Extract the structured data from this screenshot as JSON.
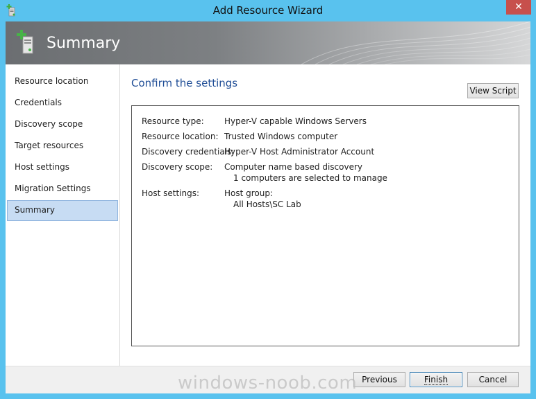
{
  "window": {
    "title": "Add Resource Wizard",
    "close_glyph": "✕"
  },
  "header": {
    "title": "Summary",
    "icon": "server-add-icon"
  },
  "sidebar": {
    "items": [
      {
        "label": "Resource location",
        "selected": false
      },
      {
        "label": "Credentials",
        "selected": false
      },
      {
        "label": "Discovery scope",
        "selected": false
      },
      {
        "label": "Target resources",
        "selected": false
      },
      {
        "label": "Host settings",
        "selected": false
      },
      {
        "label": "Migration Settings",
        "selected": false
      },
      {
        "label": "Summary",
        "selected": true
      }
    ]
  },
  "main": {
    "heading": "Confirm the settings",
    "view_script_label": "View Script",
    "summary": {
      "resource_type_label": "Resource type:",
      "resource_type_value": "Hyper-V capable Windows Servers",
      "resource_location_label": "Resource location:",
      "resource_location_value": "Trusted Windows computer",
      "discovery_credentials_label": "Discovery credentials:",
      "discovery_credentials_value": "Hyper-V Host Administrator Account",
      "discovery_scope_label": "Discovery scope:",
      "discovery_scope_value": "Computer name based discovery",
      "discovery_scope_detail": "1 computers are selected to manage",
      "host_settings_label": "Host settings:",
      "host_settings_value": "Host group:",
      "host_settings_detail": "All Hosts\\SC Lab"
    }
  },
  "footer": {
    "previous_label": "Previous",
    "finish_label": "Finish",
    "cancel_label": "Cancel"
  },
  "watermark": "windows-noob.com",
  "colors": {
    "titlebar": "#59c2ee",
    "heading": "#1f4d96",
    "selected_nav": "#c7dcf3",
    "close_button": "#c7504c"
  }
}
